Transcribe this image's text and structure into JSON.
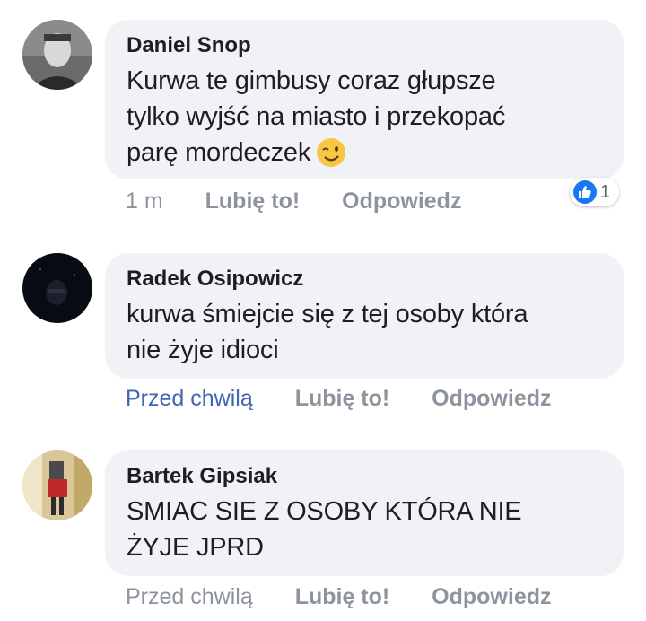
{
  "comments": [
    {
      "author": "Daniel Snop",
      "text_lines": [
        "Kurwa te gimbusy coraz głupsze",
        "tylko wyjść na miasto i przekopać",
        "parę mordeczek"
      ],
      "emoji": "wink-emoji",
      "time": "1 m",
      "like_label": "Lubię to!",
      "reply_label": "Odpowiedz",
      "reaction_count": "1"
    },
    {
      "author": "Radek Osipowicz",
      "text_lines": [
        "kurwa śmiejcie się z tej osoby która",
        "nie żyje idioci"
      ],
      "time": "Przed chwilą",
      "like_label": "Lubię to!",
      "reply_label": "Odpowiedz"
    },
    {
      "author": "Bartek Gipsiak",
      "text_lines": [
        "SMIAC SIE Z OSOBY KTÓRA NIE",
        "ŻYJE JPRD"
      ],
      "time": "Przed chwilą",
      "like_label": "Lubię to!",
      "reply_label": "Odpowiedz"
    }
  ],
  "colors": {
    "bubble_bg": "#f0f2f5",
    "meta_gray": "#8d949e",
    "link_blue": "#4267b2",
    "like_blue": "#1877f2"
  }
}
